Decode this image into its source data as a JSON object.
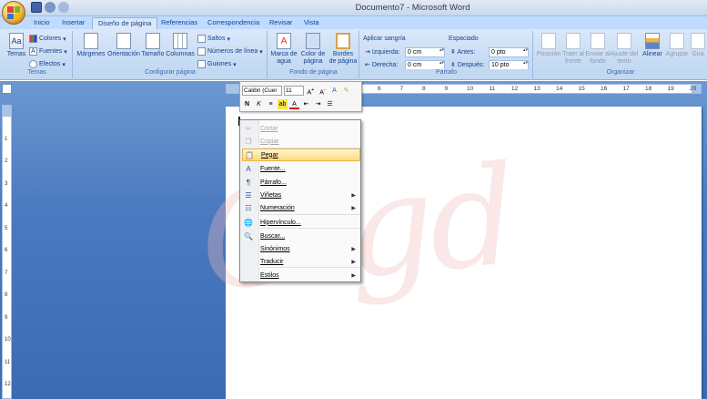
{
  "window": {
    "title": "Documento7 - Microsoft Word"
  },
  "tabs": [
    "Inicio",
    "Insertar",
    "Diseño de página",
    "Referencias",
    "Correspondencia",
    "Revisar",
    "Vista"
  ],
  "active_tab": "Diseño de página",
  "ribbon": {
    "temas": {
      "label": "Temas",
      "big_button": "Temas",
      "colores": "Colores",
      "fuentes": "Fuentes",
      "efectos": "Efectos"
    },
    "configurar": {
      "label": "Configurar página",
      "margenes": "Márgenes",
      "orientacion": "Orientación",
      "tamano": "Tamaño",
      "columnas": "Columnas",
      "saltos": "Saltos",
      "numeros_linea": "Números de línea",
      "guiones": "Guiones"
    },
    "fondo": {
      "label": "Fondo de página",
      "marca_agua_1": "Marca de",
      "marca_agua_2": "agua",
      "color_pagina_1": "Color de",
      "color_pagina_2": "página",
      "bordes_1": "Bordes",
      "bordes_2": "de página"
    },
    "parrafo": {
      "label": "Párrafo",
      "sangria_title": "Aplicar sangría",
      "izquierda_label": "Izquierda:",
      "izquierda_value": "0 cm",
      "derecha_label": "Derecha:",
      "derecha_value": "0 cm",
      "espaciado_title": "Espaciado",
      "antes_label": "Antes:",
      "antes_value": "0 pto",
      "despues_label": "Después:",
      "despues_value": "10 pto"
    },
    "organizar": {
      "label": "Organizar",
      "posicion": "Posición",
      "traer_1": "Traer al",
      "traer_2": "frente",
      "enviar_1": "Enviar al",
      "enviar_2": "fondo",
      "ajuste_1": "Ajuste del",
      "ajuste_2": "texto",
      "alinear": "Alinear",
      "agrupar": "Agrupar",
      "girar": "Gira"
    }
  },
  "mini_toolbar": {
    "font": "Calibri (Cuer",
    "size": "11"
  },
  "hruler_labels": [
    "1",
    "2",
    "3",
    "4",
    "5",
    "6",
    "7",
    "8",
    "9",
    "10",
    "11",
    "12",
    "13",
    "14",
    "15",
    "16",
    "17",
    "18",
    "19",
    "20"
  ],
  "vruler_labels": [
    "1",
    "2",
    "3",
    "4",
    "5",
    "6",
    "7",
    "8",
    "9",
    "10",
    "11",
    "12"
  ],
  "context_menu": [
    {
      "label": "Cortar",
      "icon": "scissors-icon",
      "glyph": "✂",
      "disabled": true
    },
    {
      "label": "Copiar",
      "icon": "copy-icon",
      "glyph": "❐",
      "disabled": true
    },
    {
      "label": "Pegar",
      "icon": "paste-icon",
      "glyph": "📋",
      "hover": true
    },
    {
      "label": "Fuente...",
      "icon": "font-icon",
      "glyph": "A"
    },
    {
      "label": "Párrafo...",
      "icon": "paragraph-icon",
      "glyph": "¶"
    },
    {
      "label": "Viñetas",
      "icon": "bullets-icon",
      "glyph": "☰",
      "submenu": true
    },
    {
      "label": "Numeración",
      "icon": "numbering-icon",
      "glyph": "☷",
      "submenu": true
    },
    {
      "label": "Hipervínculo...",
      "icon": "hyperlink-icon",
      "glyph": "🌐"
    },
    {
      "label": "Buscar...",
      "icon": "search-icon",
      "glyph": "🔍"
    },
    {
      "label": "Sinónimos",
      "icon": "",
      "glyph": "",
      "submenu": true
    },
    {
      "label": "Traducir",
      "icon": "",
      "glyph": "",
      "submenu": true
    },
    {
      "label": "Estilos",
      "icon": "",
      "glyph": "",
      "submenu": true
    }
  ],
  "watermark": "Olgd",
  "colors": {
    "ribbon_bg": "#dbe8f9",
    "workarea": "#4b7ac0",
    "hover": "#ffd97f",
    "text_blue": "#15428b"
  }
}
